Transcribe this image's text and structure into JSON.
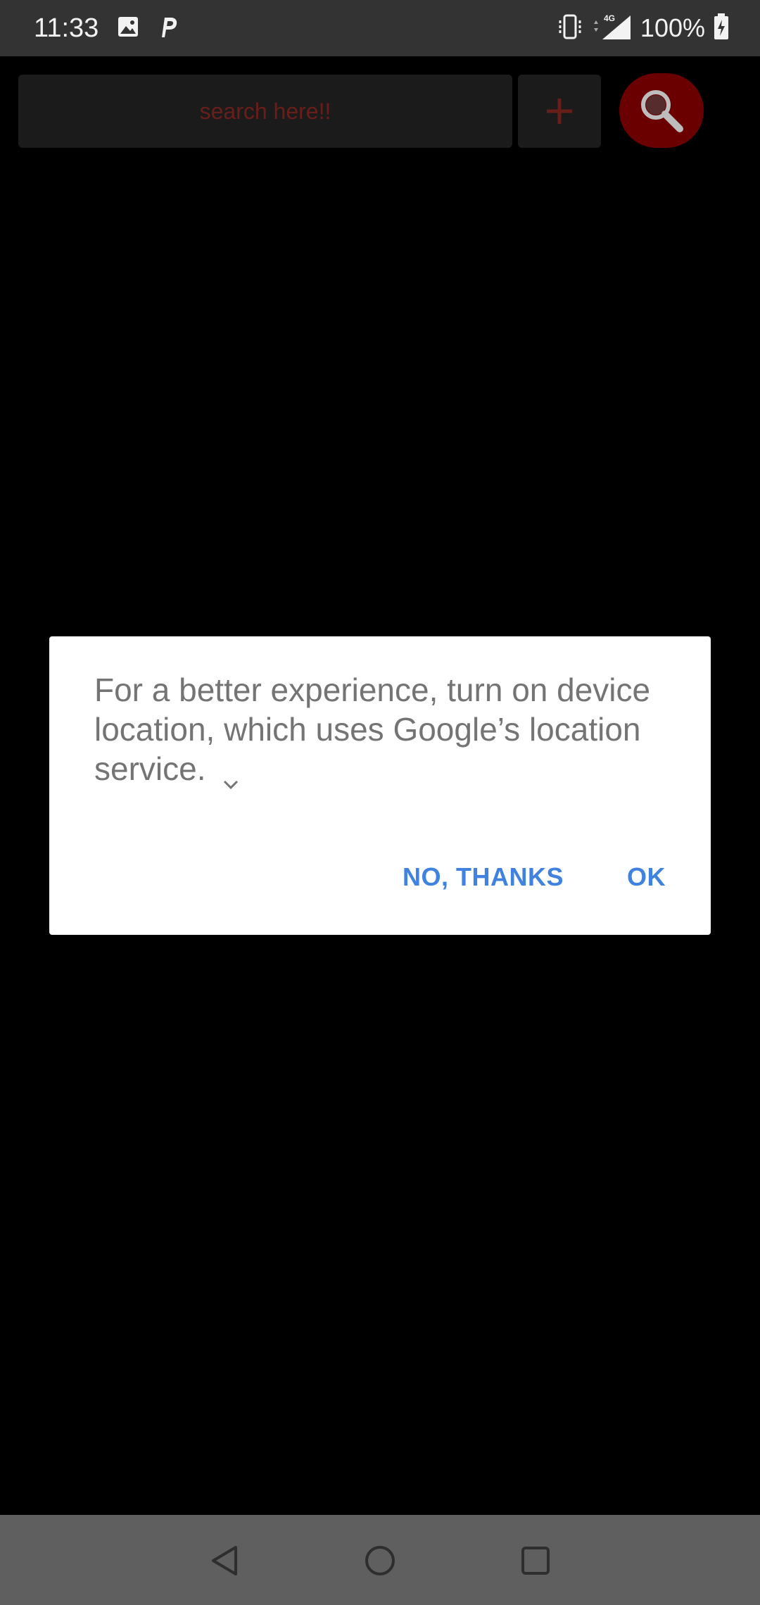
{
  "status_bar": {
    "time": "11:33",
    "battery_text": "100%",
    "left_icons": [
      "image-icon",
      "parking-icon"
    ],
    "right_icons": [
      "vibrate-icon",
      "signal-4g-icon",
      "battery-charging-icon"
    ]
  },
  "toolbar": {
    "search_placeholder": "search here!!",
    "add_icon": "plus-icon",
    "search_icon": "magnifier-icon"
  },
  "dialog": {
    "message": "For a better experience, turn on device location, which uses Google’s location service.",
    "negative_label": "NO, THANKS",
    "positive_label": "OK"
  },
  "nav_bar": {
    "icons": [
      "back-icon",
      "home-icon",
      "recents-icon"
    ]
  },
  "colors": {
    "status_bar": "#333333",
    "background": "#000000",
    "dialog_button": "#3f82e0",
    "dialog_text": "#747474",
    "search_button": "#6b0000",
    "search_text": "#6a1e1a",
    "nav_bar": "#5f5f5f"
  }
}
